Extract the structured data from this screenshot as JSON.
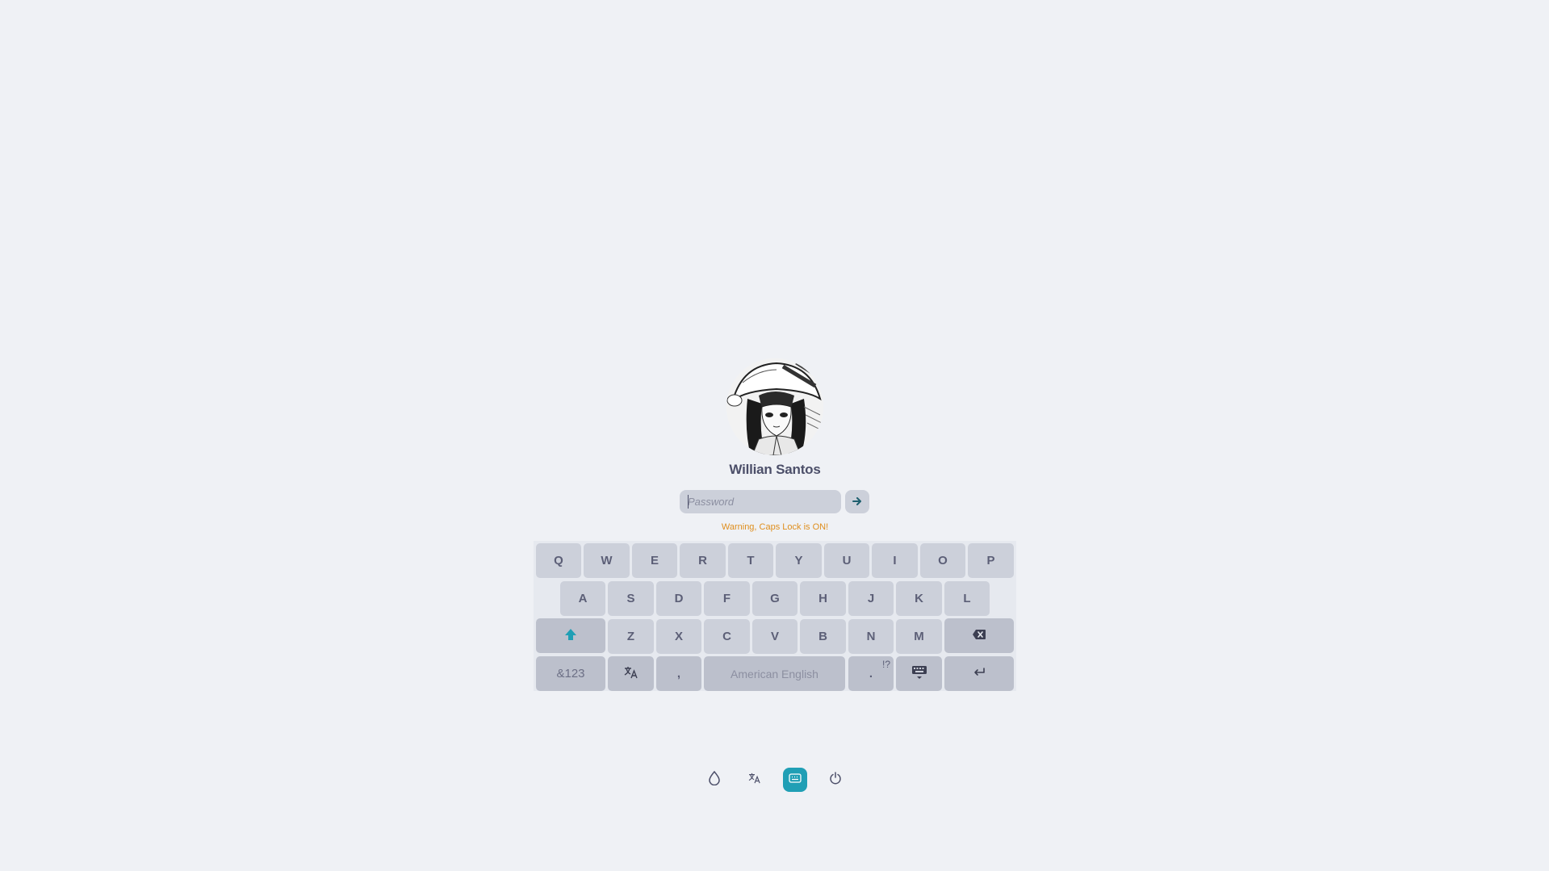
{
  "user": {
    "name": "Willian Santos",
    "avatar_icon": "avatar-manga-girl-image"
  },
  "password": {
    "value": "",
    "placeholder": "Password",
    "submit_icon": "arrow-right-icon"
  },
  "warning": "Warning, Caps Lock is ON!",
  "keyboard": {
    "row1": [
      "Q",
      "W",
      "E",
      "R",
      "T",
      "Y",
      "U",
      "I",
      "O",
      "P"
    ],
    "row2": [
      "A",
      "S",
      "D",
      "F",
      "G",
      "H",
      "J",
      "K",
      "L"
    ],
    "row3": [
      "Z",
      "X",
      "C",
      "V",
      "B",
      "N",
      "M"
    ],
    "shift_icon": "shift-arrow-icon",
    "backspace_icon": "backspace-icon",
    "symbols_label": "&123",
    "language_icon": "translate-icon",
    "comma_label": ",",
    "space_label": "American English",
    "period_label": ".",
    "period_alt_label": "!?",
    "hide_keyboard_icon": "keyboard-hide-icon",
    "enter_icon": "enter-icon"
  },
  "bottom_bar": {
    "items": [
      {
        "icon": "theme-drop-icon",
        "active": false
      },
      {
        "icon": "translate-icon",
        "active": false
      },
      {
        "icon": "keyboard-icon",
        "active": true
      },
      {
        "icon": "power-icon",
        "active": false
      }
    ]
  },
  "colors": {
    "background": "#eff1f5",
    "accent": "#209fb5",
    "warning": "#df8e1d",
    "key": "#ccd0da",
    "text": "#4c4f69"
  }
}
